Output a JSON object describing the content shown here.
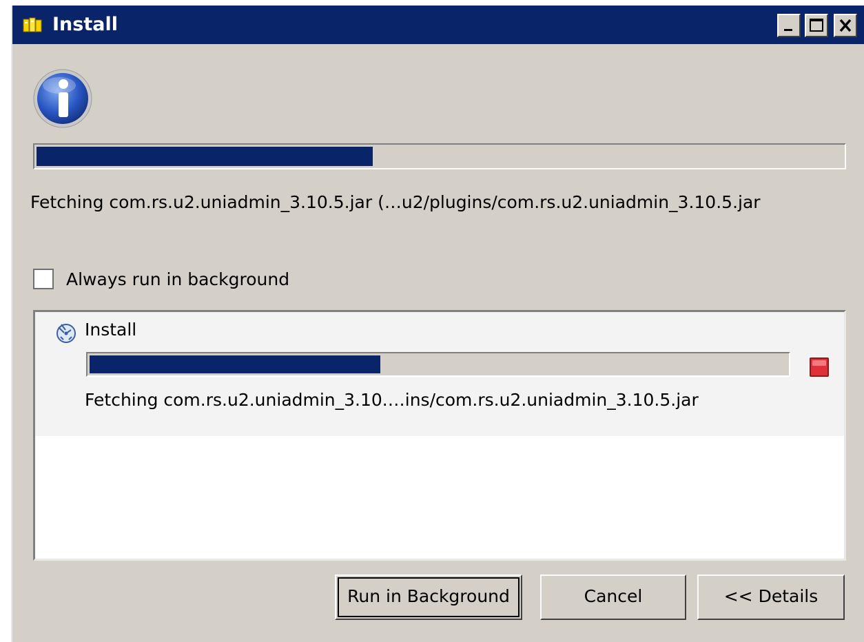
{
  "window": {
    "title": "Install",
    "title_bar_color": "#0a246a",
    "controls": [
      "minimize",
      "maximize",
      "close"
    ]
  },
  "main": {
    "icon": "info-icon",
    "progress_percent": 42,
    "status_text": "Fetching com.rs.u2.uniadmin_3.10.5.jar (…u2/plugins/com.rs.u2.uniadmin_3.10.5.jar",
    "always_background_label": "Always run in background",
    "always_background_checked": false
  },
  "details": {
    "jobs": [
      {
        "icon": "job-install-icon",
        "title": "Install",
        "progress_percent": 42,
        "status_text": "Fetching com.rs.u2.uniadmin_3.10.…ins/com.rs.u2.uniadmin_3.10.5.jar",
        "stop_icon": "stop-icon"
      }
    ]
  },
  "buttons": {
    "run_background": "Run in Background",
    "cancel": "Cancel",
    "details": "<< Details"
  }
}
